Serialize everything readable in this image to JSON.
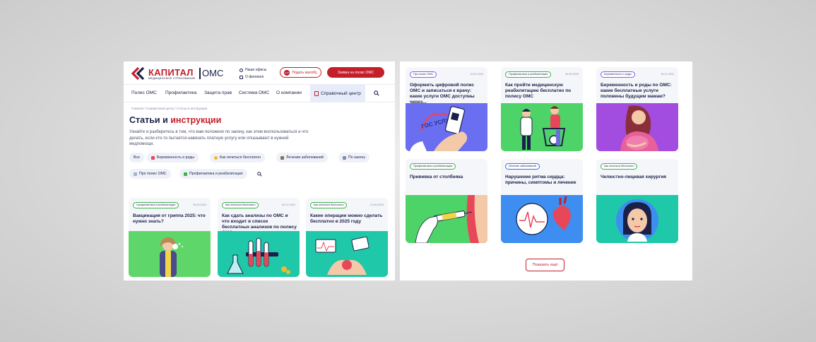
{
  "header": {
    "brand_name": "КАПИТАЛ",
    "brand_sub": "МЕДИЦИНСКОЕ СТРАХОВАНИЕ",
    "brand_oms": "ОМС",
    "link_offices": "Наши офисы",
    "link_about": "О филиале",
    "complaint_button": "Подать жалобу",
    "complaint_badge": "24/7",
    "apply_button": "Заявка на полис ОМС"
  },
  "nav": {
    "items": [
      {
        "label": "Полис ОМС"
      },
      {
        "label": "Профилактика"
      },
      {
        "label": "Защита прав"
      },
      {
        "label": "Система ОМС"
      },
      {
        "label": "О компании"
      }
    ],
    "help_center": "Справочный центр"
  },
  "breadcrumb": "Главная / Справочный центр / Статьи и инструкции",
  "page": {
    "title_plain": "Статьи и",
    "title_accent": "инструкции",
    "intro": "Узнайте и разберитесь в том, что вам положено по закону, как этим воспользоваться и что делать, если кто-то пытается навязать платную услугу или отказывают в нужной медпомощи."
  },
  "filters": [
    {
      "label": "Все",
      "color": ""
    },
    {
      "label": "Беременность и роды",
      "color": "#e8475a"
    },
    {
      "label": "Как лечиться бесплатно",
      "color": "#f2b82e"
    },
    {
      "label": "Лечение заболеваний",
      "color": "#8a6f5c"
    },
    {
      "label": "По закону",
      "color": "#7d8fb0"
    },
    {
      "label": "Про полис ОМС",
      "color": "#a7b3c9"
    },
    {
      "label": "Профилактика и реабилитация",
      "color": "#39b54a"
    }
  ],
  "left_cards": [
    {
      "tag": "Профилактика и реабилитация",
      "date": "15.09.2024",
      "title": "Вакцинация от гриппа 2025: что нужно знать?",
      "img_color": "#5fd66a"
    },
    {
      "tag": "Как лечиться бесплатно",
      "date": "08.12.2022",
      "title": "Как сдать анализы по ОМС и что входит в список бесплатных анализов по полису ОМС",
      "img_color": "#1fc8a8"
    },
    {
      "tag": "Как лечиться бесплатно",
      "date": "21.06.2023",
      "title": "Какие операции можно сделать бесплатно в 2025 году",
      "img_color": "#1fc8a8"
    }
  ],
  "right_cards": [
    {
      "tag": "Про полис ОМС",
      "date": "14.02.2023",
      "title": "Оформить цифровой полис ОМС и записаться к врачу: какие услуги ОМС доступны через...",
      "img_color": "#6a6ef0",
      "img_text": "ГОС УСЛУГИ"
    },
    {
      "tag": "Профилактика и реабилитация",
      "date": "30.08.2023",
      "title": "Как пройти медицинскую реабилитацию бесплатно по полису ОМС",
      "img_color": "#4ed368"
    },
    {
      "tag": "Беременность и роды",
      "date": "18.11.2022",
      "title": "Беременность и роды по ОМС: какие бесплатные услуги положены будущим мамам?",
      "img_color": "#a24de0"
    },
    {
      "tag": "Профилактика и реабилитация",
      "date": "",
      "title": "Прививка от столбняка",
      "img_color": "#4ed368"
    },
    {
      "tag": "Лечение заболеваний",
      "date": "",
      "title": "Нарушение ритма сердца: причины, симптомы и лечение",
      "img_color": "#3d8ef0"
    },
    {
      "tag": "Как лечиться бесплатно",
      "date": "",
      "title": "Челюстно-лицевая хирургия",
      "img_color": "#1fc8a8"
    }
  ],
  "load_more": "Показать ещё",
  "colors": {
    "brand_red": "#c41e2a",
    "navy": "#1b2049",
    "help_bg": "#e7ecfa"
  }
}
